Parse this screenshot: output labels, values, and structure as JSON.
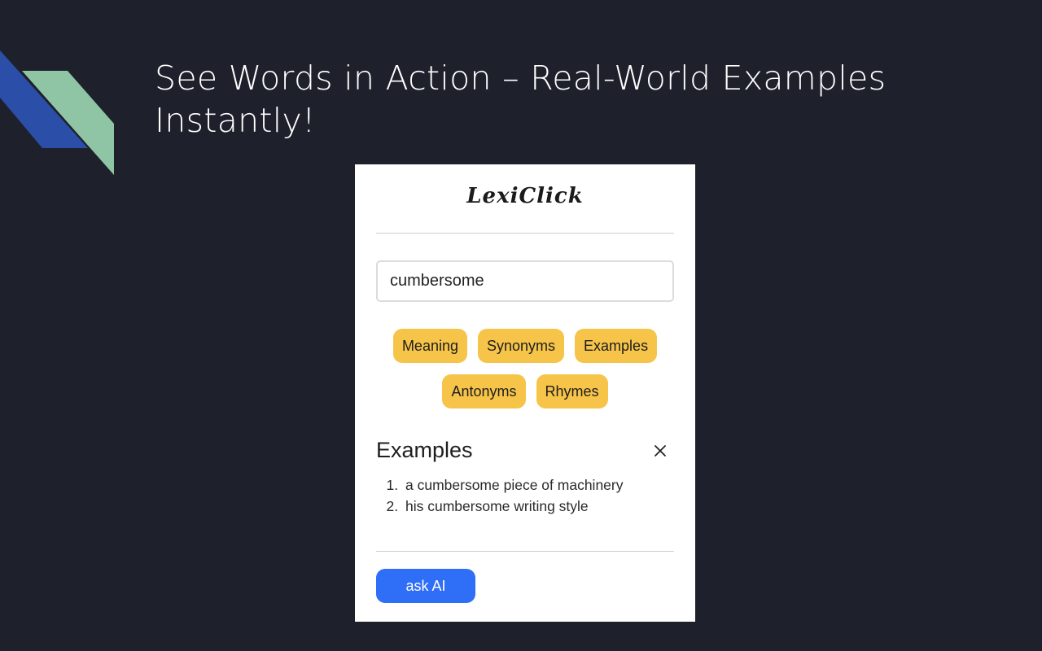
{
  "slide": {
    "headline": "See Words in Action – Real-World Examples Instantly!",
    "decor_colors": {
      "blue": "#2b4ea8",
      "green": "#8fc4a4"
    }
  },
  "popup": {
    "app_title": "LexiClick",
    "search": {
      "value": "cumbersome",
      "placeholder": ""
    },
    "buttons": [
      {
        "label": "Meaning"
      },
      {
        "label": "Synonyms"
      },
      {
        "label": "Examples"
      },
      {
        "label": "Antonyms"
      },
      {
        "label": "Rhymes"
      }
    ],
    "result": {
      "title": "Examples",
      "close_icon": "close-icon",
      "items": [
        "a cumbersome piece of machinery",
        "his cumbersome writing style"
      ]
    },
    "ask_ai_label": "ask AI"
  },
  "colors": {
    "background": "#1e212b",
    "chip": "#f7c44a",
    "primary": "#2f6ef6"
  }
}
